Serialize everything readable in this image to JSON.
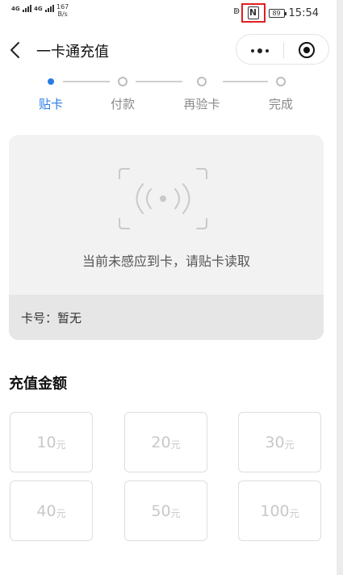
{
  "status_bar": {
    "sim1": "4G",
    "sim2": "4G",
    "net_speed": "167",
    "net_unit": "B/s",
    "battery": "89",
    "time": "15:54",
    "nfc_letter": "N",
    "nfc_highlight_color": "#e02020"
  },
  "nav": {
    "title": "一卡通充值"
  },
  "steps": [
    {
      "label": "贴卡",
      "active": true
    },
    {
      "label": "付款",
      "active": false
    },
    {
      "label": "再验卡",
      "active": false
    },
    {
      "label": "完成",
      "active": false
    }
  ],
  "accent_color": "#2c7be5",
  "card": {
    "message": "当前未感应到卡，请贴卡读取",
    "card_number_label": "卡号：暂无"
  },
  "recharge": {
    "title": "充值金额",
    "unit": "元",
    "amounts": [
      "10",
      "20",
      "30",
      "40",
      "50",
      "100"
    ]
  }
}
